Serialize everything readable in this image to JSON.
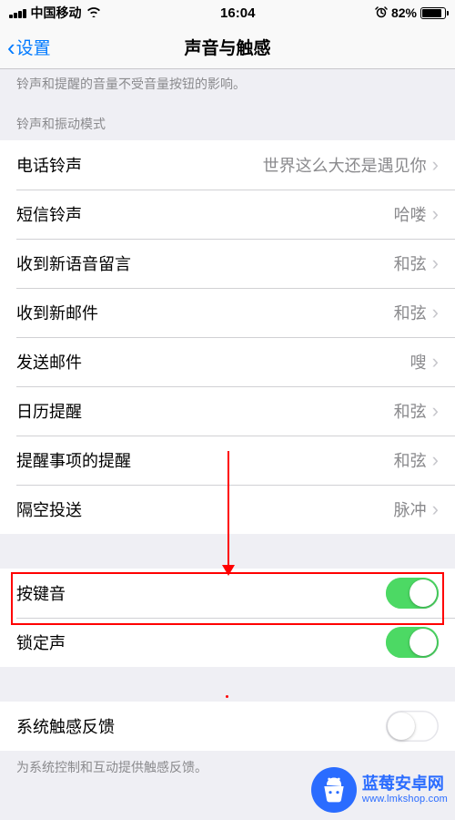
{
  "status": {
    "carrier": "中国移动",
    "time": "16:04",
    "battery_pct": "82%"
  },
  "nav": {
    "back": "设置",
    "title": "声音与触感"
  },
  "note_top": "铃声和提醒的音量不受音量按钮的影响。",
  "section_header": "铃声和振动模式",
  "rows": {
    "ringtone": {
      "label": "电话铃声",
      "value": "世界这么大还是遇见你"
    },
    "text_tone": {
      "label": "短信铃声",
      "value": "哈喽"
    },
    "voicemail": {
      "label": "收到新语音留言",
      "value": "和弦"
    },
    "new_mail": {
      "label": "收到新邮件",
      "value": "和弦"
    },
    "sent_mail": {
      "label": "发送邮件",
      "value": "嗖"
    },
    "calendar": {
      "label": "日历提醒",
      "value": "和弦"
    },
    "reminder": {
      "label": "提醒事项的提醒",
      "value": "和弦"
    },
    "airdrop": {
      "label": "隔空投送",
      "value": "脉冲"
    }
  },
  "toggles": {
    "keyboard_clicks": {
      "label": "按键音",
      "on": true
    },
    "lock_sound": {
      "label": "锁定声",
      "on": true
    },
    "system_haptics": {
      "label": "系统触感反馈",
      "on": false
    }
  },
  "footer_note": "为系统控制和互动提供触感反馈。",
  "watermark": {
    "title": "蓝莓安卓网",
    "url": "www.lmkshop.com"
  }
}
